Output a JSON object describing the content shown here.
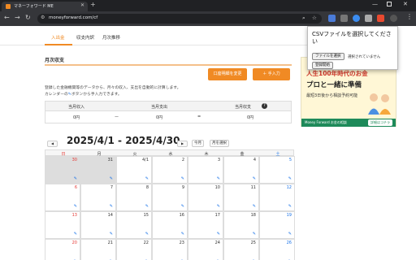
{
  "browser": {
    "tab_title": "マネーフォワード ME",
    "tab_close": "✕",
    "new_tab": "+",
    "url": "moneyforward.com/cf",
    "window_controls": {
      "minimize": "—",
      "close": "✕"
    }
  },
  "site_nav": {
    "tabs": [
      "入出金",
      "収支内訳",
      "月次推移"
    ],
    "active_index": 0,
    "accent_color": "#f08a24"
  },
  "monthly": {
    "section_title": "月次収支",
    "buttons": {
      "bank_change": "口座明細を変更",
      "manual": "手入力"
    },
    "description_1": "登録した金融機関等のデータから、月々の収入、支出を自動的に計算します。",
    "description_2_prefix": "カレンダーの",
    "description_2_suffix": "ボタンから手入力できます。",
    "summary_labels": {
      "income": "当月収入",
      "expense": "当月支出",
      "balance": "当月収支"
    },
    "summary_values": {
      "income": "0円",
      "expense": "0円",
      "balance": "0円"
    },
    "operators": {
      "minus": "ー",
      "equals": "="
    },
    "help": "?"
  },
  "calendar": {
    "range": "2025/4/1 - 2025/4/30",
    "prev": "◀",
    "next": "▶",
    "today_button": "今月",
    "select_month_button": "月を選択",
    "weekdays": [
      "日",
      "月",
      "火",
      "水",
      "木",
      "金",
      "土"
    ],
    "row1_days": [
      "30",
      "31",
      "4/1",
      "2",
      "3",
      "4",
      "5"
    ],
    "row2_days": [
      "6",
      "7",
      "8",
      "9",
      "10",
      "11",
      "12"
    ],
    "row3_days": [
      "13",
      "14",
      "15",
      "16",
      "17",
      "18",
      "19"
    ],
    "row4_days": [
      "20",
      "21",
      "22",
      "23",
      "24",
      "25",
      "26"
    ],
    "pencil": "✎"
  },
  "ad": {
    "line1": "人生100年時代のお金",
    "line2": "プロと一緒に準備",
    "line3": "最短3日後から相談予約可能",
    "footer_label": "Money Forward お金の相談",
    "cta": "詳細はコチラ"
  },
  "popup": {
    "title": "CSVファイルを選択してください",
    "choose_file": "ファイルを選択",
    "file_status": "選択されていません",
    "start": "登録開始"
  }
}
